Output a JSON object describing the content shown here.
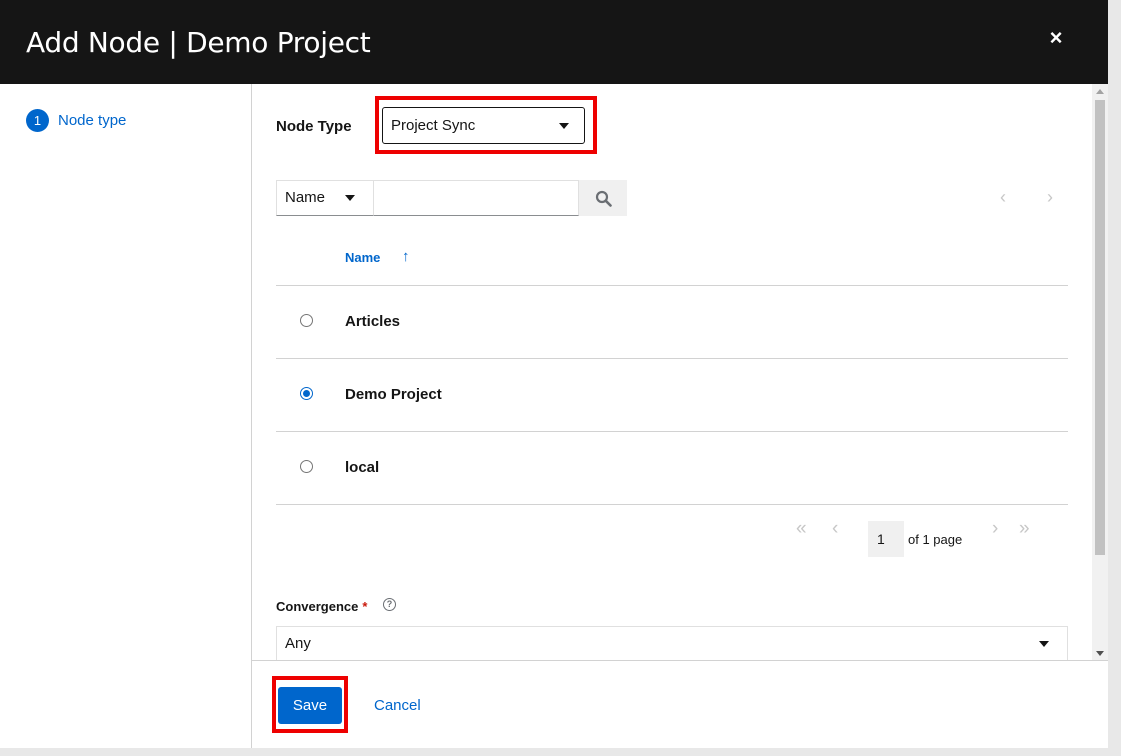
{
  "modal": {
    "title": "Add Node | Demo Project",
    "close_icon": "×"
  },
  "sidebar": {
    "steps": [
      {
        "number": "1",
        "label": "Node type"
      }
    ]
  },
  "form": {
    "node_type_label": "Node Type",
    "node_type_value": "Project Sync",
    "filter_field": "Name",
    "search_value": "",
    "column_name": "Name",
    "sort_icon": "↑",
    "rows": [
      {
        "name": "Articles",
        "selected": false
      },
      {
        "name": "Demo Project",
        "selected": true
      },
      {
        "name": "local",
        "selected": false
      }
    ],
    "pagination": {
      "page": "1",
      "of_text": "of 1 page",
      "first_icon": "«",
      "prev_icon": "‹",
      "next_icon": "›",
      "last_icon": "»"
    },
    "convergence_label": "Convergence",
    "convergence_required": "*",
    "convergence_help_icon": "?",
    "convergence_value": "Any"
  },
  "footer": {
    "save_label": "Save",
    "cancel_label": "Cancel"
  },
  "colors": {
    "primary": "#0066cc",
    "header_bg": "#151515",
    "highlight": "#ee0000"
  }
}
